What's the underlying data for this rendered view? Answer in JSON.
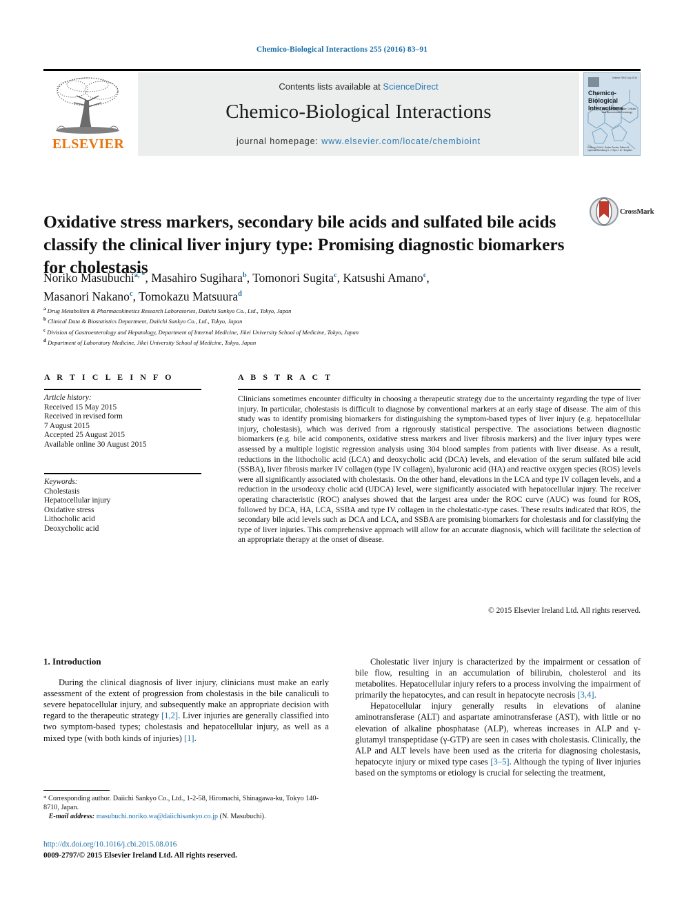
{
  "running_head": "Chemico-Biological Interactions 255 (2016) 83–91",
  "masthead": {
    "contents_prefix": "Contents lists available at ",
    "sciencedirect": "ScienceDirect",
    "journal_title": "Chemico-Biological Interactions",
    "homepage_prefix": "journal homepage: ",
    "homepage_url": "www.elsevier.com/locate/chembioint",
    "publisher": "ELSEVIER",
    "cover": {
      "title": "Chemico-Biological Interactions",
      "subtitle": "A Journal of Molecular, Cellular and Biochemical Toxicology",
      "top_right": "Volume 255\n5 July 2016",
      "bottom_left": "Editor-in-Chief\nA. Sarkar\nSection Editors\nM. Ingelman-Sundberg\nH. J. Sips\nJ. M. Hengstler"
    },
    "colors": {
      "link": "#2a7ab0",
      "band": "#eceded",
      "elsevier_orange": "#e8730a",
      "running_head": "#1a6fa8"
    }
  },
  "article": {
    "title": "Oxidative stress markers, secondary bile acids and sulfated bile acids classify the clinical liver injury type: Promising diagnostic biomarkers for cholestasis",
    "crossmark_label": "CrossMark",
    "authors": [
      {
        "name": "Noriko Masubuchi",
        "marks": "a, *"
      },
      {
        "name": "Masahiro Sugihara",
        "marks": "b"
      },
      {
        "name": "Tomonori Sugita",
        "marks": "c"
      },
      {
        "name": "Katsushi Amano",
        "marks": "c"
      },
      {
        "name": "Masanori Nakano",
        "marks": "c"
      },
      {
        "name": "Tomokazu Matsuura",
        "marks": "d"
      }
    ],
    "affiliations": [
      {
        "mark": "a",
        "text": "Drug Metabolism & Pharmacokinetics Research Laboratories, Daiichi Sankyo Co., Ltd., Tokyo, Japan"
      },
      {
        "mark": "b",
        "text": "Clinical Data & Biostatistics Department, Daiichi Sankyo Co., Ltd., Tokyo, Japan"
      },
      {
        "mark": "c",
        "text": "Division of Gastroenterology and Hepatology, Department of Internal Medicine, Jikei University School of Medicine, Tokyo, Japan"
      },
      {
        "mark": "d",
        "text": "Department of Laboratory Medicine, Jikei University School of Medicine, Tokyo, Japan"
      }
    ]
  },
  "info": {
    "heading": "A R T I C L E    I N F O",
    "history_label": "Article history:",
    "history": [
      "Received 15 May 2015",
      "Received in revised form",
      "7 August 2015",
      "Accepted 25 August 2015",
      "Available online 30 August 2015"
    ],
    "keywords_label": "Keywords:",
    "keywords": [
      "Cholestasis",
      "Hepatocellular injury",
      "Oxidative stress",
      "Lithocholic acid",
      "Deoxycholic acid"
    ]
  },
  "abstract": {
    "heading": "A B S T R A C T",
    "text": "Clinicians sometimes encounter difficulty in choosing a therapeutic strategy due to the uncertainty regarding the type of liver injury. In particular, cholestasis is difficult to diagnose by conventional markers at an early stage of disease. The aim of this study was to identify promising biomarkers for distinguishing the symptom-based types of liver injury (e.g. hepatocellular injury, cholestasis), which was derived from a rigorously statistical perspective. The associations between diagnostic biomarkers (e.g. bile acid components, oxidative stress markers and liver fibrosis markers) and the liver injury types were assessed by a multiple logistic regression analysis using 304 blood samples from patients with liver disease. As a result, reductions in the lithocholic acid (LCA) and deoxycholic acid (DCA) levels, and elevation of the serum sulfated bile acid (SSBA), liver fibrosis marker IV collagen (type IV collagen), hyaluronic acid (HA) and reactive oxygen species (ROS) levels were all significantly associated with cholestasis. On the other hand, elevations in the LCA and type IV collagen levels, and a reduction in the ursodeoxy cholic acid (UDCA) level, were significantly associated with hepatocellular injury. The receiver operating characteristic (ROC) analyses showed that the largest area under the ROC curve (AUC) was found for ROS, followed by DCA, HA, LCA, SSBA and type IV collagen in the cholestatic-type cases. These results indicated that ROS, the secondary bile acid levels such as DCA and LCA, and SSBA are promising biomarkers for cholestasis and for classifying the type of liver injuries. This comprehensive approach will allow for an accurate diagnosis, which will facilitate the selection of an appropriate therapy at the onset of disease.",
    "copyright": "© 2015 Elsevier Ireland Ltd. All rights reserved."
  },
  "body": {
    "section_number_title": "1.  Introduction",
    "left_paragraph_1_a": "During the clinical diagnosis of liver injury, clinicians must make an early assessment of the extent of progression from cholestasis in the bile canaliculi to severe hepatocellular injury, and subsequently make an appropriate decision with regard to the therapeutic strategy ",
    "left_ref_1": "[1,2]",
    "left_paragraph_1_b": ". Liver injuries are generally classified into two symptom-based types; cholestasis and hepatocellular injury, as well as a mixed type (with both kinds of injuries) ",
    "left_ref_2": "[1]",
    "left_paragraph_1_c": ".",
    "right_paragraph_1_a": "Cholestatic liver injury is characterized by the impairment or cessation of bile flow, resulting in an accumulation of bilirubin, cholesterol and its metabolites. Hepatocellular injury refers to a process involving the impairment of primarily the hepatocytes, and can result in hepatocyte necrosis ",
    "right_ref_1": "[3,4]",
    "right_paragraph_1_b": ".",
    "right_paragraph_2_a": "Hepatocellular injury generally results in elevations of alanine aminotransferase (ALT) and aspartate aminotransferase (AST), with little or no elevation of alkaline phosphatase (ALP), whereas increases in ALP and γ-glutamyl transpeptidase (γ-GTP) are seen in cases with cholestasis. Clinically, the ALP and ALT levels have been used as the criteria for diagnosing cholestasis, hepatocyte injury or mixed type cases ",
    "right_ref_2": "[3–5]",
    "right_paragraph_2_b": ". Although the typing of liver injuries based on the symptoms or etiology is crucial for selecting the treatment,"
  },
  "footer": {
    "corresponding_star": "*",
    "corresponding_text": " Corresponding author. Daiichi Sankyo Co., Ltd., 1-2-58, Hiromachi, Shinagawa-ku, Tokyo 140-8710, Japan.",
    "email_label": "E-mail address:",
    "email": "masubuchi.noriko.wa@daiichisankyo.co.jp",
    "email_suffix": " (N. Masubuchi).",
    "doi": "http://dx.doi.org/10.1016/j.cbi.2015.08.016",
    "issn_line": "0009-2797/© 2015 Elsevier Ireland Ltd. All rights reserved."
  }
}
